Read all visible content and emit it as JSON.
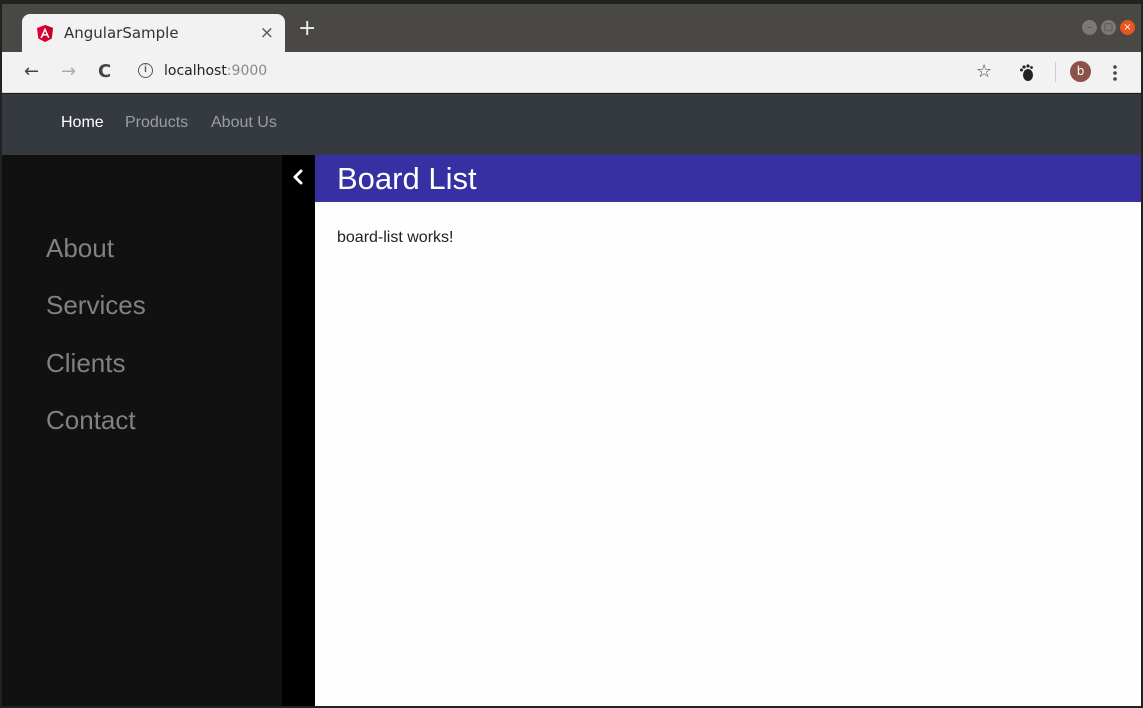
{
  "browser": {
    "tab_title": "AngularSample",
    "tab_close": "×",
    "new_tab": "+",
    "url_host": "localhost",
    "url_port": ":9000",
    "avatar_letter": "b",
    "icons": [
      "back-icon",
      "forward-icon",
      "reload-icon",
      "info-icon",
      "star-icon",
      "extension-icon",
      "menu-icon"
    ]
  },
  "navbar": {
    "links": [
      {
        "label": "Home",
        "active": true
      },
      {
        "label": "Products",
        "active": false
      },
      {
        "label": "About Us",
        "active": false
      }
    ]
  },
  "sidebar": {
    "items": [
      {
        "label": "About"
      },
      {
        "label": "Services"
      },
      {
        "label": "Clients"
      },
      {
        "label": "Contact"
      }
    ]
  },
  "main": {
    "title": "Board List",
    "body_text": "board-list works!"
  },
  "colors": {
    "navbar_bg": "#343a40",
    "sidebar_bg": "#111111",
    "header_bg": "#3630a3"
  }
}
